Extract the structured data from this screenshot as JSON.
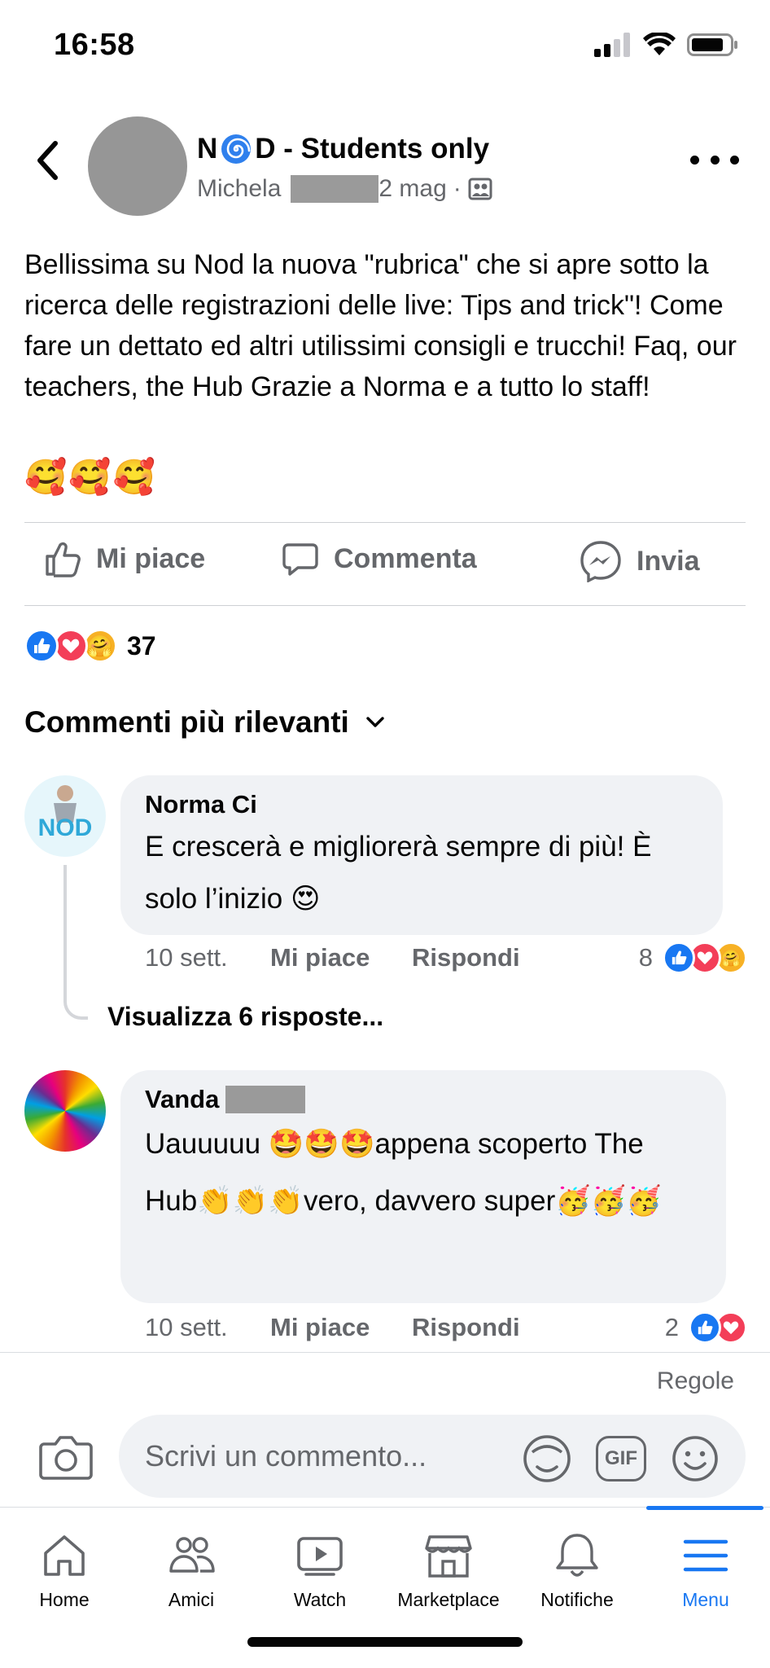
{
  "status_bar": {
    "time": "16:58",
    "battery_level": 0.8
  },
  "post": {
    "group_name_prefix": "N",
    "group_name_suffix": "D - Students only",
    "author": "Michela",
    "date": "2 mag",
    "separator": "·",
    "text": "Bellissima su Nod la nuova \"rubrica\" che si apre sotto la ricerca delle registrazioni delle live: Tips and trick\"! Come fare un dettato  ed altri utilissimi consigli e trucchi! Faq, our teachers, the Hub Grazie a Norma e a tutto lo staff!",
    "emojis": "🥰🥰🥰"
  },
  "actions": {
    "like": "Mi piace",
    "comment": "Commenta",
    "send": "Invia"
  },
  "reactions": {
    "count": "37",
    "types": [
      "like",
      "love",
      "care"
    ]
  },
  "comments_filter": {
    "label": "Commenti più rilevanti"
  },
  "comments": [
    {
      "author": "Norma Ci",
      "avatar_text": "NOD",
      "text": "E crescerà e migliorerà sempre di più! È solo l’inizio 😍",
      "time": "10 sett.",
      "like": "Mi piace",
      "reply": "Rispondi",
      "reaction_count": "8",
      "reaction_types": [
        "like",
        "love",
        "care"
      ]
    },
    {
      "author": "Vanda",
      "text": "Uauuuuu 🤩🤩🤩appena scoperto The Hub👏👏👏vero, davvero super🥳🥳🥳",
      "time": "10 sett.",
      "like": "Mi piace",
      "reply": "Rispondi",
      "reaction_count": "2",
      "reaction_types": [
        "like",
        "love"
      ]
    }
  ],
  "view_replies": "Visualizza 6 risposte...",
  "composer": {
    "rules": "Regole",
    "placeholder": "Scrivi un commento...",
    "gif_label": "GIF"
  },
  "tabbar": {
    "active": "Menu",
    "tabs": [
      {
        "label": "Home",
        "icon": "home-icon"
      },
      {
        "label": "Amici",
        "icon": "friends-icon"
      },
      {
        "label": "Watch",
        "icon": "watch-icon"
      },
      {
        "label": "Marketplace",
        "icon": "marketplace-icon"
      },
      {
        "label": "Notifiche",
        "icon": "bell-icon"
      },
      {
        "label": "Menu",
        "icon": "menu-icon"
      }
    ]
  },
  "colors": {
    "accent": "#1877f2",
    "love": "#f33e58",
    "care": "#f7b125",
    "secondary_text": "#65676b",
    "bubble": "#f0f2f5"
  }
}
